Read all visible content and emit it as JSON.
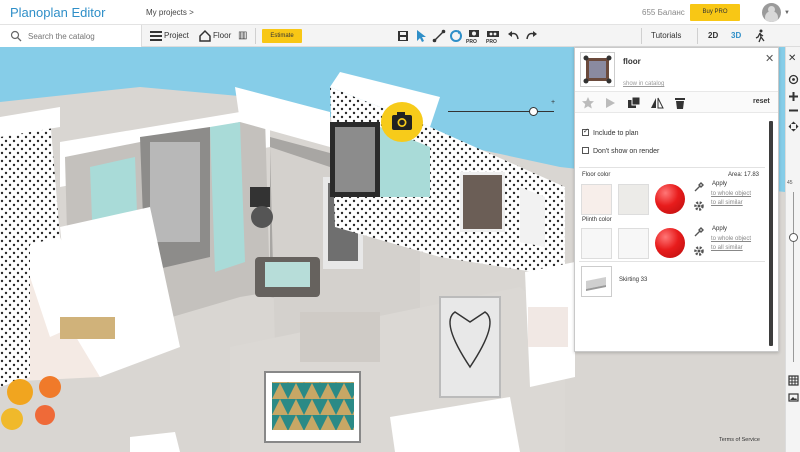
{
  "app": {
    "title": "Planoplan Editor",
    "accent": "#2f8fc8",
    "yellow": "#f8c715"
  },
  "header": {
    "my_projects": "My projects >",
    "balance": "655 Баланс",
    "buy_label": "Buy PRO"
  },
  "toolbar": {
    "search_placeholder": "Search the catalog",
    "project_label": "Project",
    "floor_label": "Floor",
    "estimate_label": "Estimate",
    "pro_tag_1": "PRO",
    "pro_tag_2": "PRO",
    "tutorials_label": "Tutorials",
    "view_2d": "2D",
    "view_3d": "3D"
  },
  "viewport": {
    "zoom_plus": "+"
  },
  "panel": {
    "title": "floor",
    "show_in_catalog": "show in catalog",
    "reset": "reset",
    "include_to_plan": "Include to plan",
    "include_checked": true,
    "dont_show_on_render": "Don't show on render",
    "floor_color_label": "Floor color",
    "area_label": "Area: 17.83",
    "apply_label_1": "Apply",
    "to_whole_object_1": "to whole object",
    "to_all_similar_1": "to all similar",
    "plinth_color_label": "Plinth color",
    "apply_label_2": "Apply",
    "to_whole_object_2": "to whole object",
    "to_all_similar_2": "to all similar",
    "skirting_label": "Skirting 33",
    "floor_swatch_color": "#f7eeea",
    "accent_ball_color": "#e81c1c"
  },
  "side_strip": {
    "label_45": "45"
  },
  "footer": {
    "terms": "Terms of Service"
  }
}
